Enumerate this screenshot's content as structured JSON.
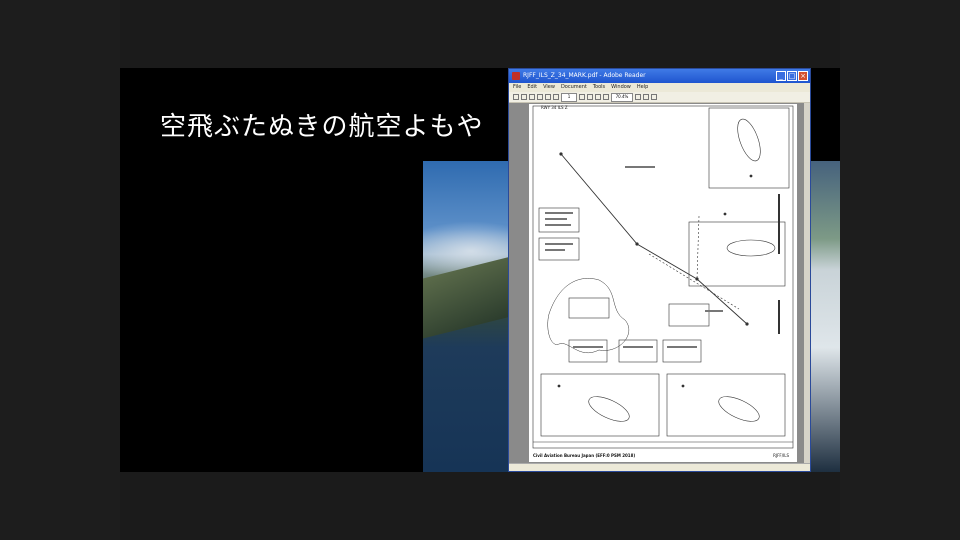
{
  "video": {
    "title": "空飛ぶたぬきの航空よもや"
  },
  "viewer": {
    "window_title": "RJFF_ILS_Z_34_MARK.pdf - Adobe Reader",
    "menu": [
      "File",
      "Edit",
      "View",
      "Document",
      "Tools",
      "Window",
      "Help"
    ],
    "zoom": "70.4%",
    "page_number": "1",
    "status": ""
  },
  "chart_doc": {
    "header_label": "RWY 34 ILS Z",
    "footer_left": "Civil Aviation Bureau Japan (EFF:0 PSM 2018)",
    "footer_right": "RJFF/ILS"
  },
  "colors": {
    "titlebar": "#1f55cf",
    "close": "#d4502e"
  }
}
